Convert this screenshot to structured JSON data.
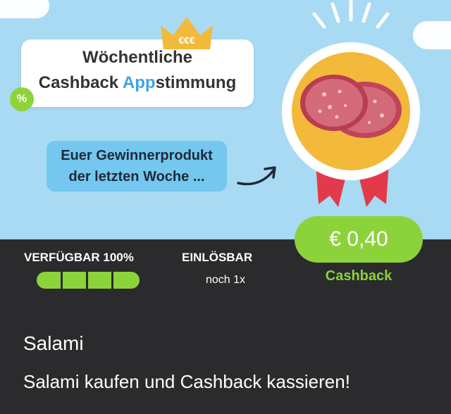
{
  "banner": {
    "title_line1": "Wöchentliche",
    "title_line2_part1": "Cashback ",
    "title_line2_accent": "App",
    "title_line2_part2": "stimmung",
    "percent_badge": "%",
    "crown_text": "€€€",
    "winner_line1": "Euer Gewinnerprodukt",
    "winner_line2": "der letzten Woche ...",
    "icons": {
      "crown": "crown-icon",
      "arrow": "arrow-icon",
      "medal": "medal-icon",
      "percent": "percent-badge-icon"
    }
  },
  "availability": {
    "label": "VERFÜGBAR 100%",
    "fill_fraction": 1.0,
    "segments": 4
  },
  "redeemable": {
    "label": "EINLÖSBAR",
    "value": "noch 1x"
  },
  "cashback": {
    "amount": "€ 0,40",
    "label": "Cashback"
  },
  "product": {
    "name": "Salami",
    "description": "Salami kaufen und Cashback kassieren!"
  },
  "colors": {
    "accent_green": "#8cd33b",
    "banner_blue": "#a9daf3",
    "dark_bg": "#2b2b2d",
    "medal_gold": "#f3b93a",
    "ribbon_red": "#e23a4a",
    "accent_blue": "#3fa3e6"
  }
}
